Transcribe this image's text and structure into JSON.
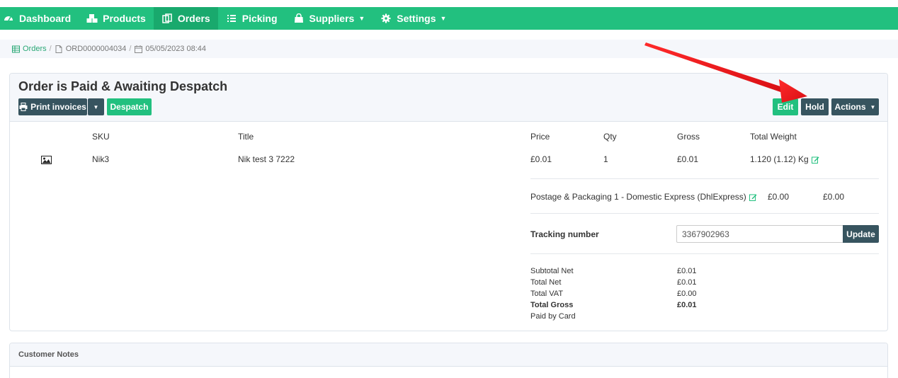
{
  "nav": {
    "items": [
      {
        "label": "Dashboard",
        "icon": "dashboard-icon"
      },
      {
        "label": "Products",
        "icon": "cubes-icon"
      },
      {
        "label": "Orders",
        "icon": "copy-icon",
        "active": true
      },
      {
        "label": "Picking",
        "icon": "list-icon"
      },
      {
        "label": "Suppliers",
        "icon": "shopping-bag-icon",
        "dropdown": true
      },
      {
        "label": "Settings",
        "icon": "gear-icon",
        "dropdown": true
      }
    ],
    "accent": "#22c07f",
    "active_bg": "#19a96d"
  },
  "breadcrumb": {
    "orders": "Orders",
    "order_id": "ORD0000004034",
    "date": "05/05/2023 08:44"
  },
  "order": {
    "title": "Order is Paid & Awaiting Despatch",
    "buttons": {
      "print_invoices": "Print invoices",
      "despatch": "Despatch",
      "edit": "Edit",
      "hold": "Hold",
      "actions": "Actions"
    },
    "columns": {
      "sku": "SKU",
      "title": "Title",
      "price": "Price",
      "qty": "Qty",
      "gross": "Gross",
      "total_weight": "Total Weight"
    },
    "line": {
      "sku": "Nik3",
      "title": "Nik test 3 7222",
      "price": "£0.01",
      "qty": "1",
      "gross": "£0.01",
      "weight": "1.120 (1.12) Kg"
    },
    "postage": {
      "label": "Postage & Packaging 1 - Domestic Express (DhlExpress)",
      "net": "£0.00",
      "gross": "£0.00"
    },
    "tracking": {
      "label": "Tracking number",
      "value": "3367902963",
      "button": "Update"
    },
    "totals": {
      "subtotal_net_label": "Subtotal Net",
      "subtotal_net": "£0.01",
      "total_net_label": "Total Net",
      "total_net": "£0.01",
      "total_vat_label": "Total VAT",
      "total_vat": "£0.00",
      "total_gross_label": "Total Gross",
      "total_gross": "£0.01",
      "paid_by": "Paid by Card"
    }
  },
  "customer_notes": {
    "title": "Customer Notes"
  },
  "colors": {
    "dark_button": "#37545f",
    "green_button": "#22c07f",
    "arrow": "#e8141b"
  }
}
